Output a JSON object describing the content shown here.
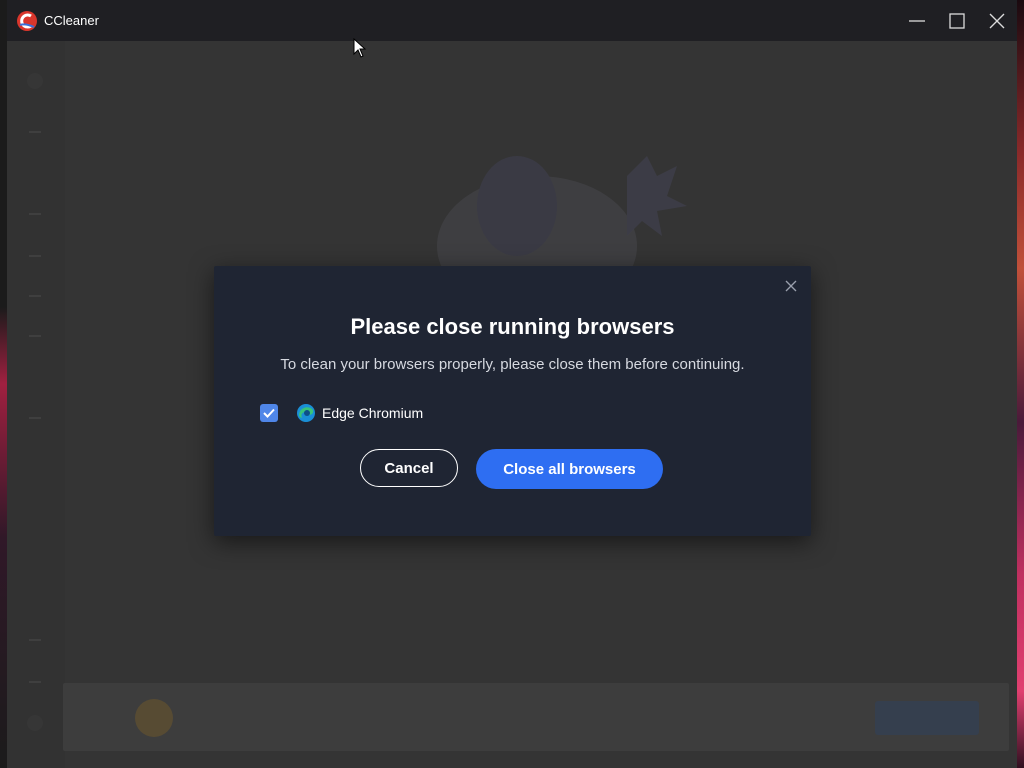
{
  "window": {
    "title": "CCleaner",
    "logo_icon": "ccleaner-logo",
    "controls": [
      "minimize-icon",
      "maximize-icon",
      "close-icon"
    ]
  },
  "dialog": {
    "close_icon": "close-icon",
    "title": "Please close running browsers",
    "subtitle": "To clean your browsers properly, please close them before continuing.",
    "browsers": [
      {
        "label": "Edge Chromium",
        "checked": true,
        "icon": "edge-icon"
      }
    ],
    "cancel_label": "Cancel",
    "primary_label": "Close all browsers"
  },
  "colors": {
    "dialog_bg": "#1f2533",
    "primary": "#2e6ef2",
    "checkbox": "#4f86e8",
    "titlebar": "#1f1f23"
  }
}
